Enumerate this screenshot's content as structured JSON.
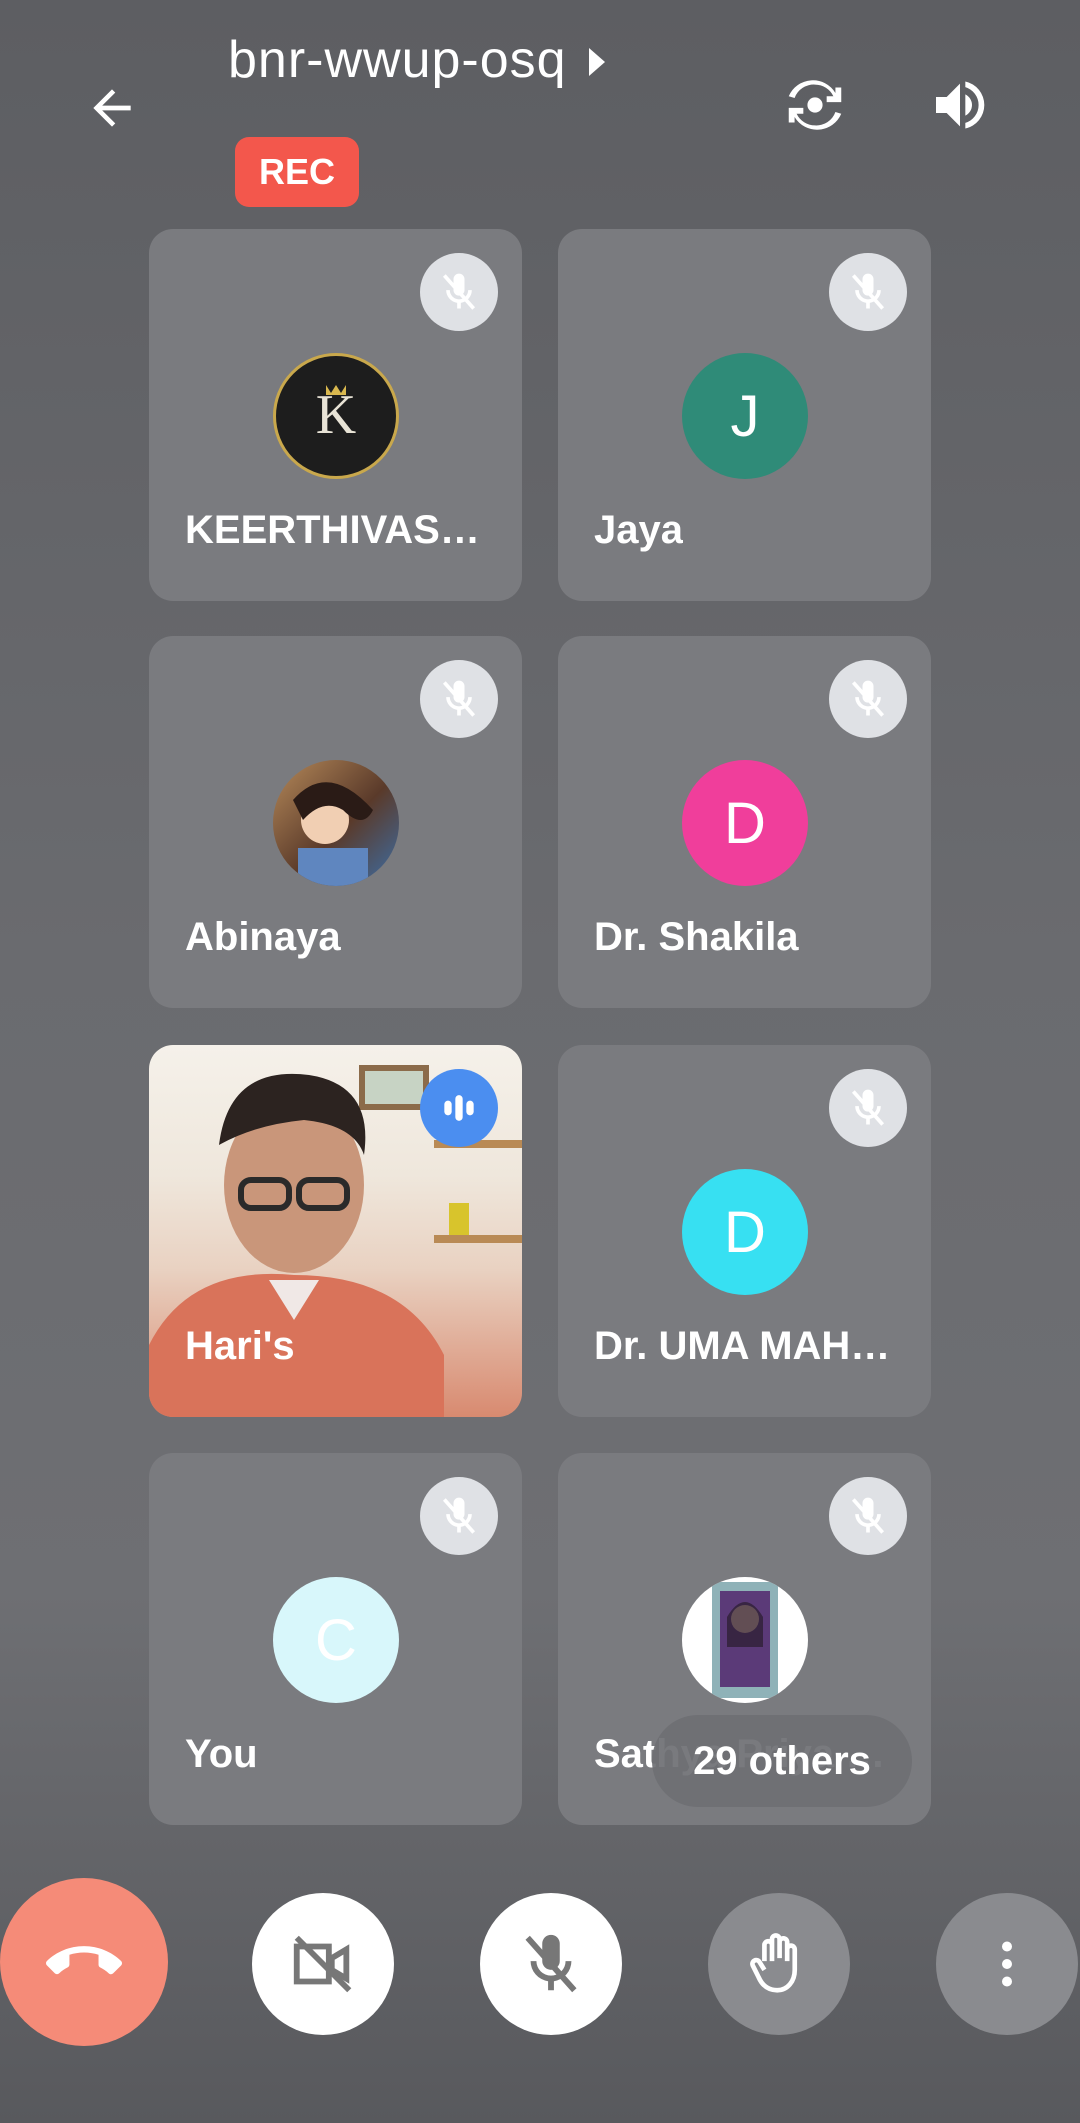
{
  "header": {
    "meeting_code": "bnr-wwup-osq",
    "recording_label": "REC"
  },
  "participants": [
    {
      "name": "KEERTHIVASA…",
      "avatar_type": "photo-logo"
    },
    {
      "name": "Jaya",
      "avatar_letter": "J",
      "avatar_color": "#2f8b78"
    },
    {
      "name": "Abinaya",
      "avatar_type": "photo"
    },
    {
      "name": "Dr. Shakila",
      "avatar_letter": "D",
      "avatar_color": "#f03e9b"
    },
    {
      "name": "Hari's",
      "avatar_type": "live-video",
      "speaking": true
    },
    {
      "name": "Dr. UMA MAHE…",
      "avatar_letter": "D",
      "avatar_color": "#37e0f2"
    },
    {
      "name": "You",
      "avatar_letter": "C",
      "avatar_color": "#d8f7fb"
    },
    {
      "name": "Sathya Priya B…",
      "avatar_type": "photo"
    }
  ],
  "others_count_label": "29 others",
  "controls": {
    "end_call_icon": "end-call-icon",
    "camera_icon": "camera-off-icon",
    "mic_icon": "mic-off-icon",
    "hand_icon": "raise-hand-icon",
    "more_icon": "more-vert-icon"
  }
}
